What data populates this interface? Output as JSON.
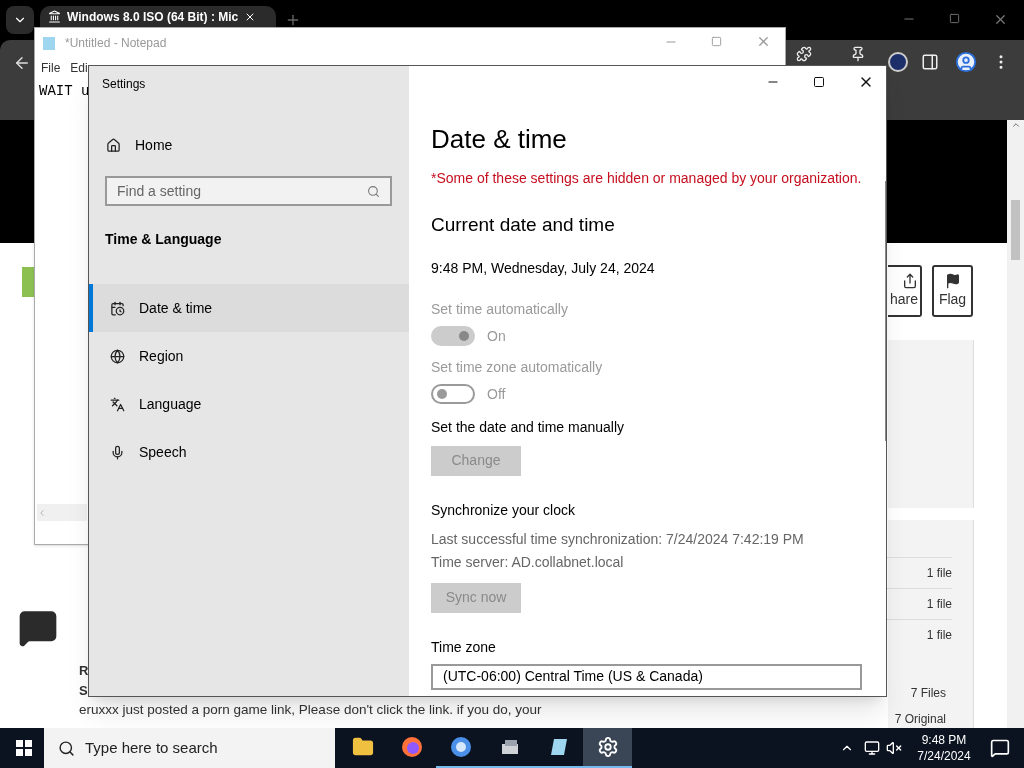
{
  "browser": {
    "tab_title": "Windows 8.0 ISO (64 Bit) : Mic",
    "page": {
      "comment_author": "R",
      "comment_subject": "S",
      "comment_text": "eruxxx just posted a porn game link, Please don't click the link. if you do, your",
      "buttons": [
        {
          "label": "hare"
        },
        {
          "label": "Flag"
        }
      ],
      "file_counts": [
        "1 file",
        "1 file",
        "1 file"
      ],
      "totals": [
        "7 Files",
        "7 Original"
      ]
    }
  },
  "notepad": {
    "title": "*Untitled - Notepad",
    "menu": [
      "File",
      "Edi"
    ],
    "text": "WAIT u"
  },
  "settings": {
    "title": "Settings",
    "home": "Home",
    "search": {
      "placeholder": "Find a setting"
    },
    "section": "Time & Language",
    "nav": [
      {
        "label": "Date & time",
        "selected": true
      },
      {
        "label": "Region",
        "selected": false
      },
      {
        "label": "Language",
        "selected": false
      },
      {
        "label": "Speech",
        "selected": false
      }
    ],
    "heading": "Date & time",
    "warning": "*Some of these settings are hidden or managed by your organization.",
    "subheading": "Current date and time",
    "current": "9:48 PM, Wednesday, July 24, 2024",
    "toggles": [
      {
        "label": "Set time automatically",
        "on": true,
        "disabled": true,
        "state_text": "On"
      },
      {
        "label": "Set time zone automatically",
        "on": false,
        "disabled": true,
        "state_text": "Off"
      }
    ],
    "manual": {
      "label": "Set the date and time manually",
      "button": "Change",
      "disabled": true
    },
    "sync": {
      "heading": "Synchronize your clock",
      "last": "Last successful time synchronization: 7/24/2024 7:42:19 PM",
      "server": "Time server: AD.collabnet.local",
      "button": "Sync now",
      "disabled": true
    },
    "time_zone": {
      "label": "Time zone",
      "value": "(UTC-06:00) Central Time (US & Canada)"
    }
  },
  "taskbar": {
    "search_placeholder": "Type here to search",
    "apps": [
      {
        "running": false,
        "selected": false
      },
      {
        "running": false,
        "selected": false
      },
      {
        "running": true,
        "selected": false
      },
      {
        "running": true,
        "selected": false
      },
      {
        "running": true,
        "selected": false
      },
      {
        "running": true,
        "selected": true
      }
    ],
    "time": "9:48 PM",
    "date": "7/24/2024"
  }
}
